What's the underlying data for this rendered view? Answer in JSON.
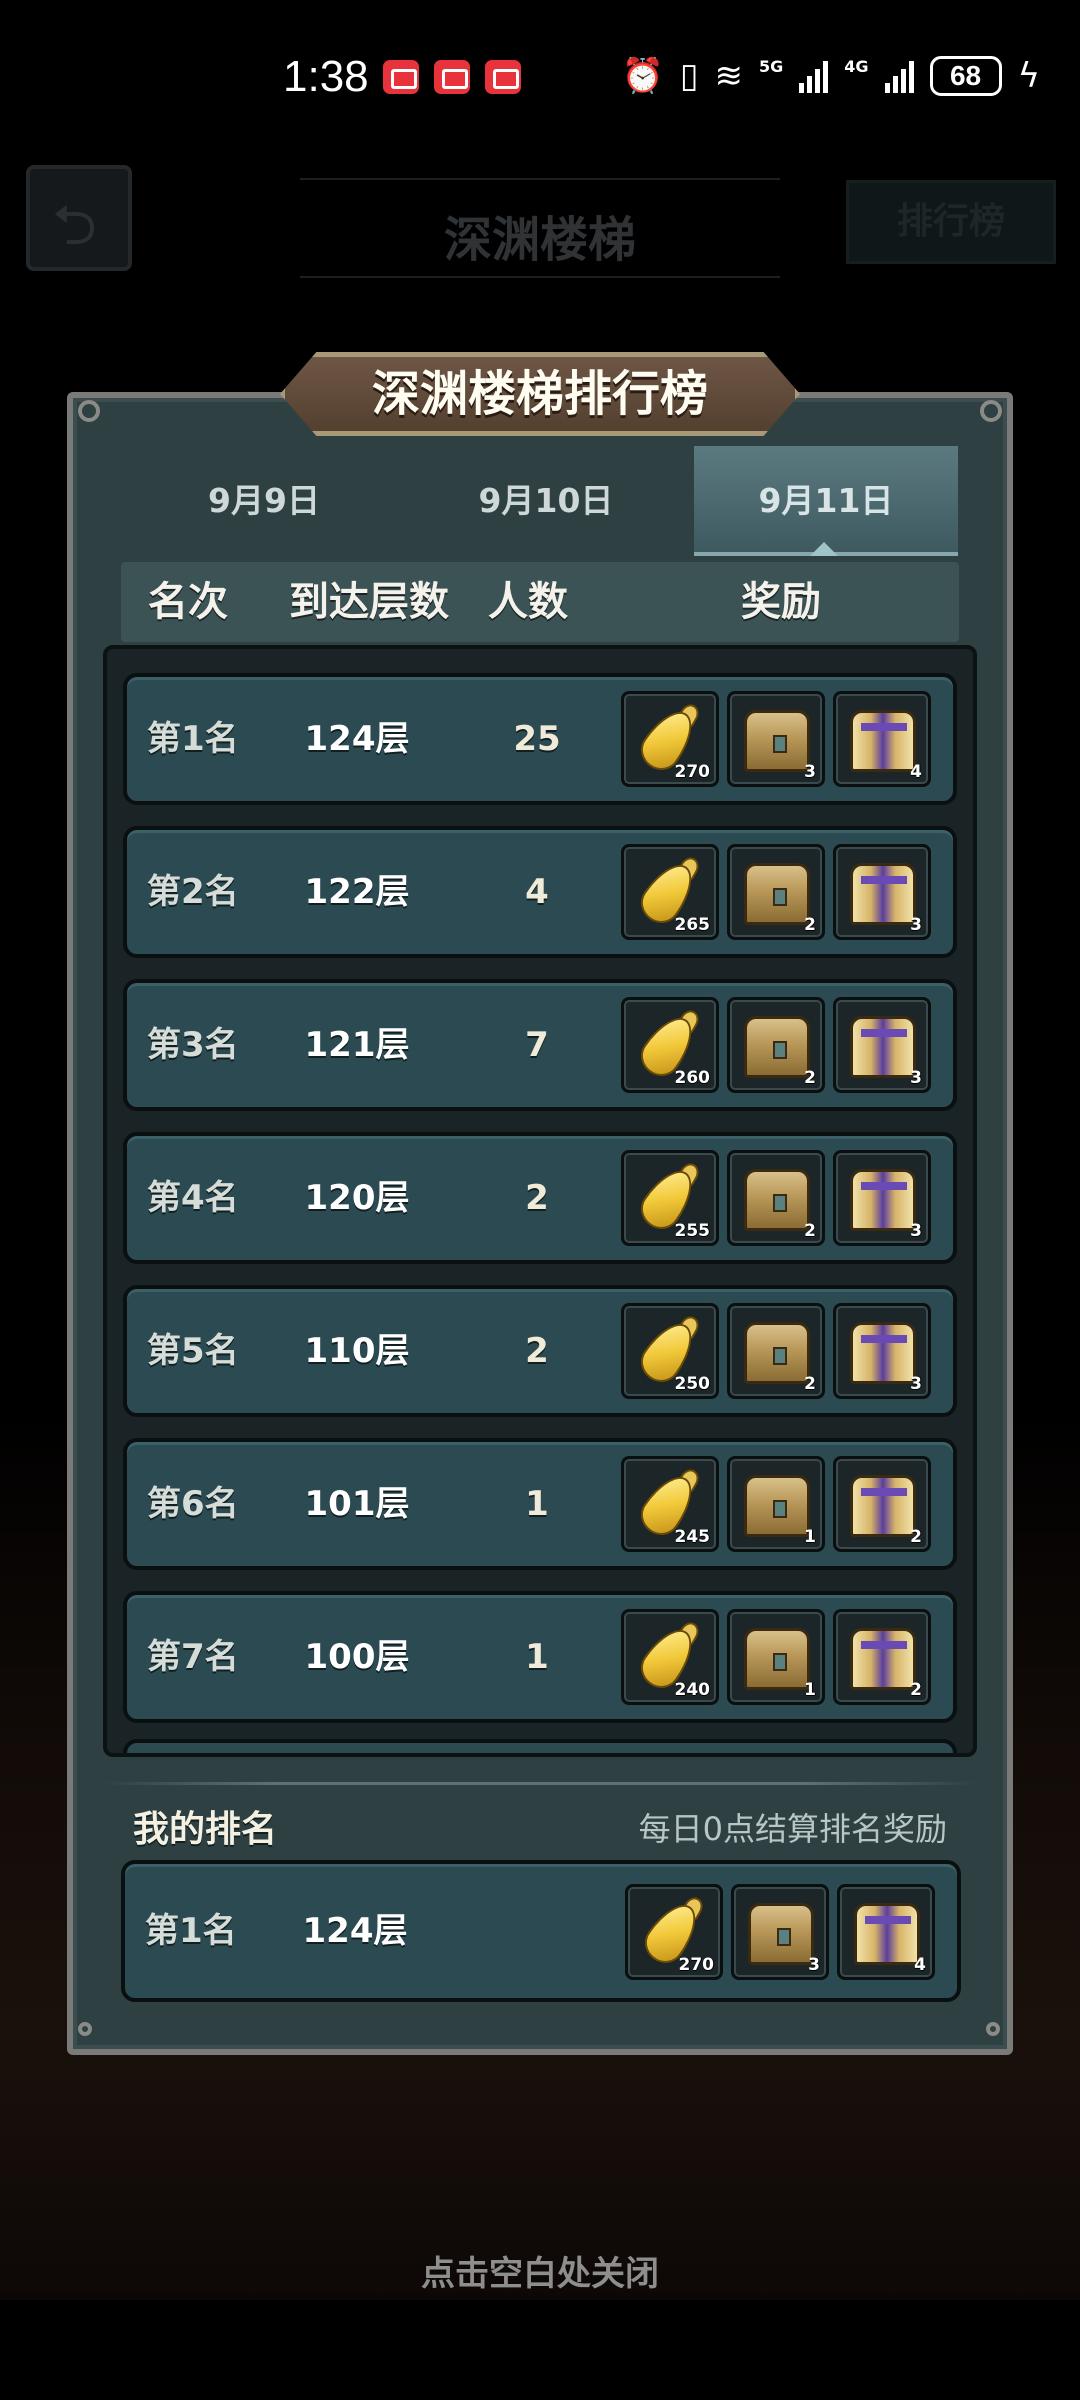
{
  "status_bar": {
    "time": "1:38",
    "network_5g": "5G",
    "network_4g": "4G",
    "battery": "68",
    "icons": [
      "notification-icon",
      "notification-icon",
      "notification-icon",
      "alarm-icon",
      "vibrate-icon",
      "wifi-icon",
      "signal-icon",
      "signal-icon",
      "charging-icon"
    ]
  },
  "background": {
    "title": "深渊楼梯",
    "rank_button": "排行榜"
  },
  "dialog": {
    "title": "深渊楼梯排行榜",
    "tabs": [
      {
        "label": "9月9日",
        "active": false
      },
      {
        "label": "9月10日",
        "active": false
      },
      {
        "label": "9月11日",
        "active": true
      }
    ],
    "columns": {
      "rank": "名次",
      "floor": "到达层数",
      "count": "人数",
      "reward": "奖励"
    },
    "rows": [
      {
        "rank": "第1名",
        "floor": "124层",
        "count": "25",
        "rewards": [
          "270",
          "3",
          "4"
        ]
      },
      {
        "rank": "第2名",
        "floor": "122层",
        "count": "4",
        "rewards": [
          "265",
          "2",
          "3"
        ]
      },
      {
        "rank": "第3名",
        "floor": "121层",
        "count": "7",
        "rewards": [
          "260",
          "2",
          "3"
        ]
      },
      {
        "rank": "第4名",
        "floor": "120层",
        "count": "2",
        "rewards": [
          "255",
          "2",
          "3"
        ]
      },
      {
        "rank": "第5名",
        "floor": "110层",
        "count": "2",
        "rewards": [
          "250",
          "2",
          "3"
        ]
      },
      {
        "rank": "第6名",
        "floor": "101层",
        "count": "1",
        "rewards": [
          "245",
          "1",
          "2"
        ]
      },
      {
        "rank": "第7名",
        "floor": "100层",
        "count": "1",
        "rewards": [
          "240",
          "1",
          "2"
        ]
      }
    ],
    "reward_icons": [
      "carrot-icon",
      "gold-chest-icon",
      "purple-chest-icon"
    ],
    "my_rank": {
      "label": "我的排名",
      "note": "每日0点结算排名奖励",
      "rank": "第1名",
      "floor": "124层",
      "rewards": [
        "270",
        "3",
        "4"
      ]
    }
  },
  "close_hint": "点击空白处关闭",
  "colors": {
    "panel": "#2e4042",
    "row": "#2c4a52",
    "active_tab": "#4c6a70",
    "banner": "#5e4838"
  }
}
